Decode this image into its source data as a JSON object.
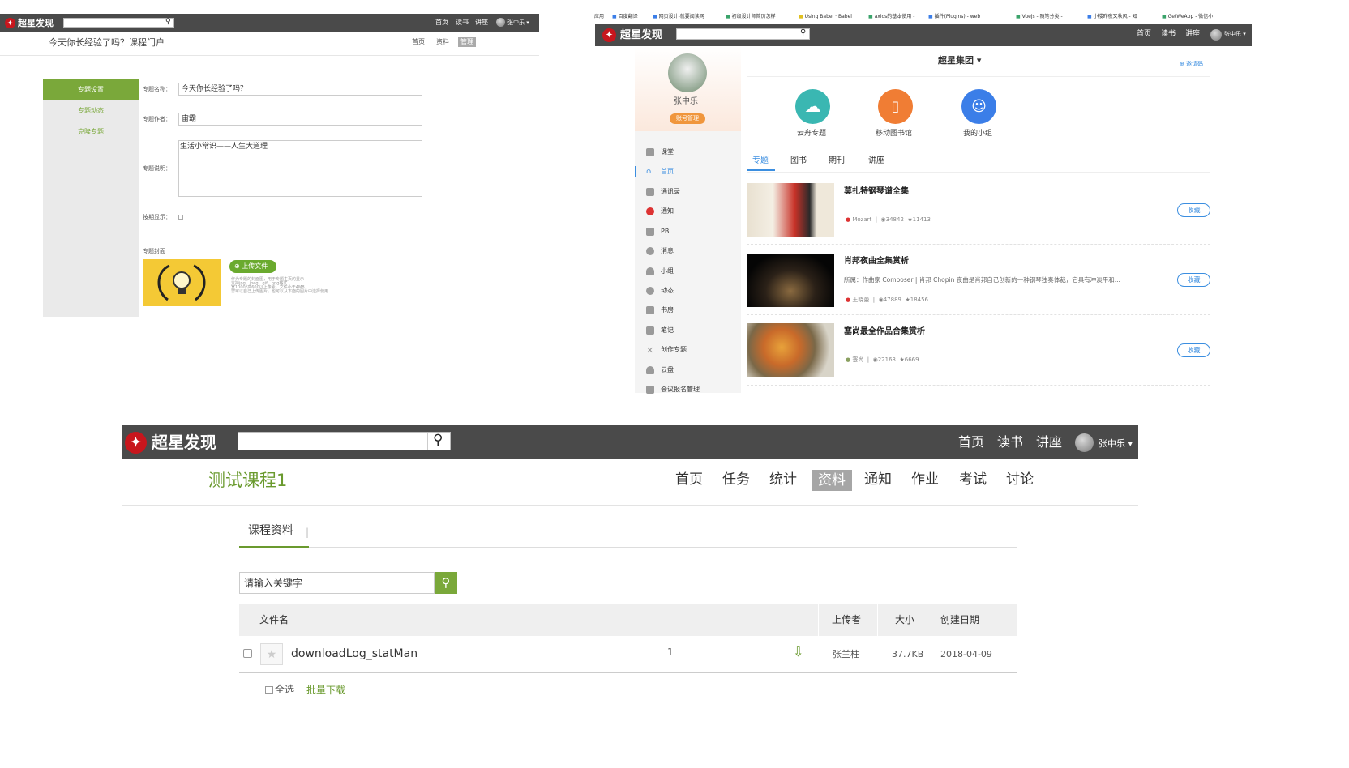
{
  "colors": {
    "topbar": "#4a4a4a",
    "green_accent": "#6a9a2e",
    "blue_accent": "#3b8ee0",
    "teal": "#3ab7b2",
    "orange": "#f07d34",
    "blue_circle": "#3b7ee8"
  },
  "p1": {
    "brand": "超星发现",
    "nav": [
      "首页",
      "读书",
      "讲座"
    ],
    "user": "张中乐",
    "title": "今天你长经验了吗？课程门户",
    "subnav": [
      "首页",
      "资料",
      "管理"
    ],
    "sidebar": [
      "专题设置",
      "专题动态",
      "克隆专题"
    ],
    "form": {
      "name_label": "专题名称：",
      "name_value": "今天你长经验了吗？",
      "author_label": "专题作者：",
      "author_value": "宙霸",
      "desc_label": "专题说明：",
      "desc_value": "生活小常识——人生大道理",
      "show_label": "按期显示：",
      "cover_label": "专题封面",
      "upload_label": "上传文件",
      "tips": [
        "作为专题的封面图，用于专题主页的显示",
        "支持jpg、jpeg、gif、png格式",
        "宽1000*高600以上像素，文件小于4MB",
        "您可以自己上传图片，也可以从下面的图片中选择使用"
      ]
    }
  },
  "p2": {
    "bookmarks": [
      "应用",
      "百度翻译",
      "网页设计-就要阅读网",
      "初级设计师简历怎样",
      "Using Babel · Babel",
      "axios的基本使用 -",
      "插件(Plugins) - web",
      "Vuejs - 随笔分类 -",
      "小楼昨夜又秋风 - 知",
      "GetWeApp - 微信小"
    ],
    "brand": "超星发现",
    "nav": [
      "首页",
      "读书",
      "讲座"
    ],
    "user": "张中乐",
    "profile_name": "张中乐",
    "account_btn": "账号管理",
    "sidebar": [
      "课堂",
      "首页",
      "通讯录",
      "通知",
      "PBL",
      "消息",
      "小组",
      "动态",
      "书房",
      "笔记",
      "创作专题",
      "云盘",
      "会议报名管理"
    ],
    "group": "超星集团",
    "invite": "邀请码",
    "apps": [
      {
        "label": "云舟专题",
        "color": "#3ab7b2"
      },
      {
        "label": "移动图书馆",
        "color": "#f07d34"
      },
      {
        "label": "我的小组",
        "color": "#3b7ee8"
      }
    ],
    "tabs": [
      "专题",
      "图书",
      "期刊",
      "讲座"
    ],
    "cards": [
      {
        "title": "莫扎特钢琴谱全集",
        "desc": "",
        "author": "Mozart",
        "views": "34842",
        "stars": "11413",
        "btn": "收藏"
      },
      {
        "title": "肖邦夜曲全集赏析",
        "desc": "所属：作曲家 Composer | 肖邦 Chopin 夜曲是肖邦自己创新的一种钢琴独奏体裁，它具有冲淡平和...",
        "author": "王晓蕾",
        "views": "47889",
        "stars": "18456",
        "btn": "收藏"
      },
      {
        "title": "塞尚最全作品合集赏析",
        "desc": "",
        "author": "塞尚",
        "views": "22163",
        "stars": "6669",
        "btn": "收藏"
      }
    ]
  },
  "p3": {
    "brand": "超星发现",
    "nav": [
      "首页",
      "读书",
      "讲座"
    ],
    "user": "张中乐",
    "course_title": "测试课程1",
    "course_nav": [
      "首页",
      "任务",
      "统计",
      "资料",
      "通知",
      "作业",
      "考试",
      "讨论"
    ],
    "tab": "课程资料",
    "search_placeholder": "请输入关键字",
    "table": {
      "headers": [
        "文件名",
        "上传者",
        "大小",
        "创建日期"
      ],
      "rows": [
        {
          "name": "downloadLog_statMan",
          "count": "1",
          "uploader": "张兰柱",
          "size": "37.7KB",
          "date": "2018-04-09"
        }
      ]
    },
    "select_all": "全选",
    "batch_download": "批量下载"
  }
}
